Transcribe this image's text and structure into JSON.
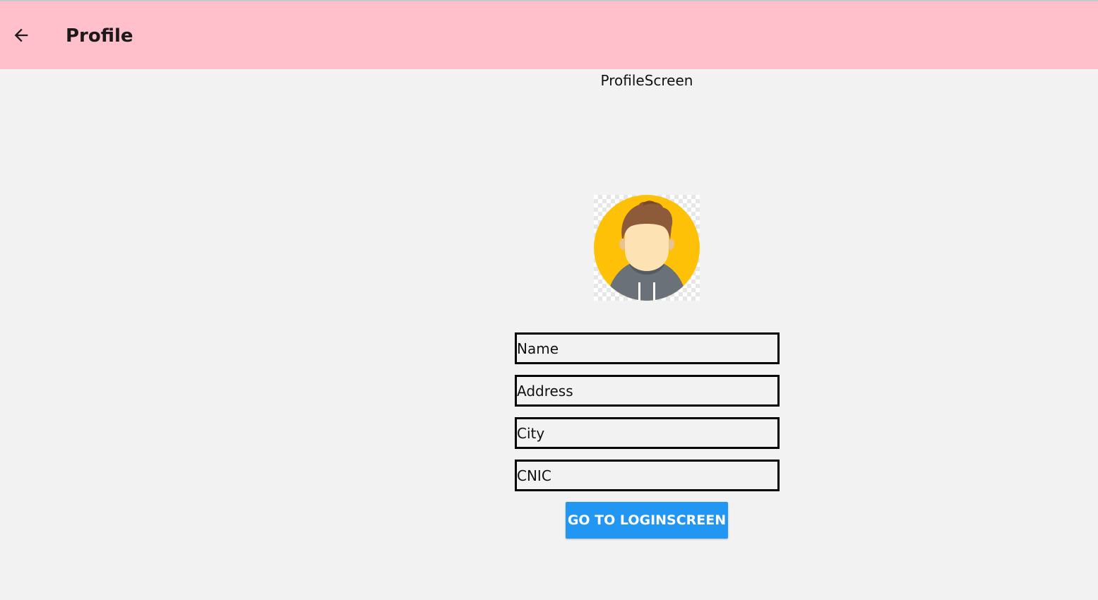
{
  "header": {
    "title": "Profile",
    "back_icon": "arrow-left-icon",
    "background": "#ffc0cb"
  },
  "screen_label": "ProfileScreen",
  "avatar": {
    "icon": "user-avatar-icon"
  },
  "form": {
    "fields": [
      {
        "placeholder": "Name",
        "value": ""
      },
      {
        "placeholder": "Address",
        "value": ""
      },
      {
        "placeholder": "City",
        "value": ""
      },
      {
        "placeholder": "CNIC",
        "value": ""
      }
    ]
  },
  "button": {
    "label": "GO TO LOGINSCREEN",
    "color": "#2196f3"
  }
}
